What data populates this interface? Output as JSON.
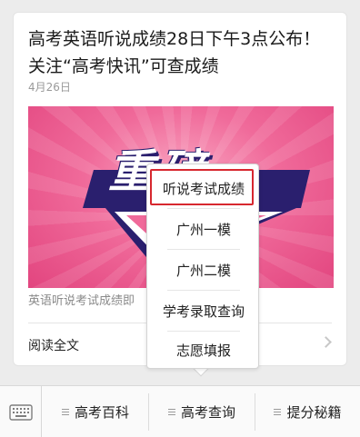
{
  "article": {
    "title": "高考英语听说成绩28日下午3点公布！关注“高考快讯”可查成绩",
    "date": "4月26日",
    "cover_text": "重磅",
    "summary": "英语听说考试成绩即",
    "read_more": "阅读全文"
  },
  "popup_menu": {
    "items": [
      "听说考试成绩",
      "广州一模",
      "广州二模",
      "学考录取查询",
      "志愿填报"
    ],
    "highlighted_index": 0,
    "highlight_color": "#d7282f"
  },
  "menubar": {
    "keyboard_icon": "keyboard-icon",
    "buttons": [
      "高考百科",
      "高考查询",
      "提分秘籍"
    ]
  },
  "colors": {
    "cover_pink": "#f06a9a",
    "cover_navy": "#2a1f6e"
  }
}
